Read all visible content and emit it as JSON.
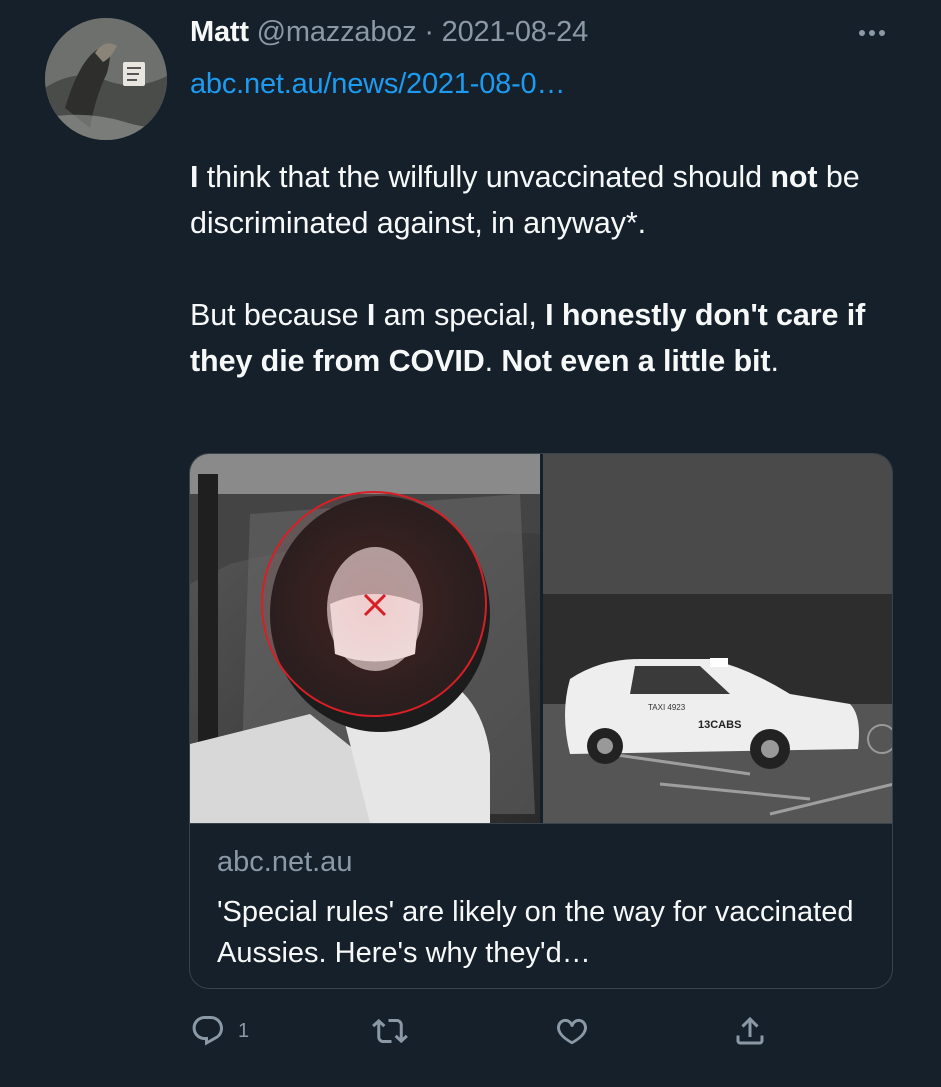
{
  "tweet": {
    "author_name": "Matt",
    "author_handle": "@mazzaboz",
    "separator": "·",
    "date": "2021-08-24",
    "link_text": "abc.net.au/news/2021-08-0…",
    "paragraph1": {
      "s1": "I",
      "s2": " think that the wilfully unvaccinated should ",
      "s3": "not",
      "s4": " be discriminated against, in anyway*."
    },
    "paragraph2": {
      "s1": "But because ",
      "s2": "I",
      "s3": " am special, ",
      "s4": "I honestly don't care if they die from COVID",
      "s5": ". ",
      "s6": "Not even a little bit",
      "s7": "."
    }
  },
  "card": {
    "domain": "abc.net.au",
    "title": "'Special rules' are likely on the way for vaccinated Aussies. Here's why they'd…",
    "image_text": {
      "taxi_plate": "TAXI 4923",
      "taxi_brand": "13CABS"
    }
  },
  "actions": {
    "reply_count": "1"
  },
  "icons": {
    "more": "more-horizontal-icon",
    "reply": "reply-icon",
    "retweet": "retweet-icon",
    "like": "heart-icon",
    "share": "share-icon"
  },
  "colors": {
    "background": "#15202b",
    "text": "#f7f9f9",
    "secondary_text": "#8b98a5",
    "link": "#1d9bf0",
    "border": "#38444d",
    "annotation_red": "#d81f26"
  }
}
